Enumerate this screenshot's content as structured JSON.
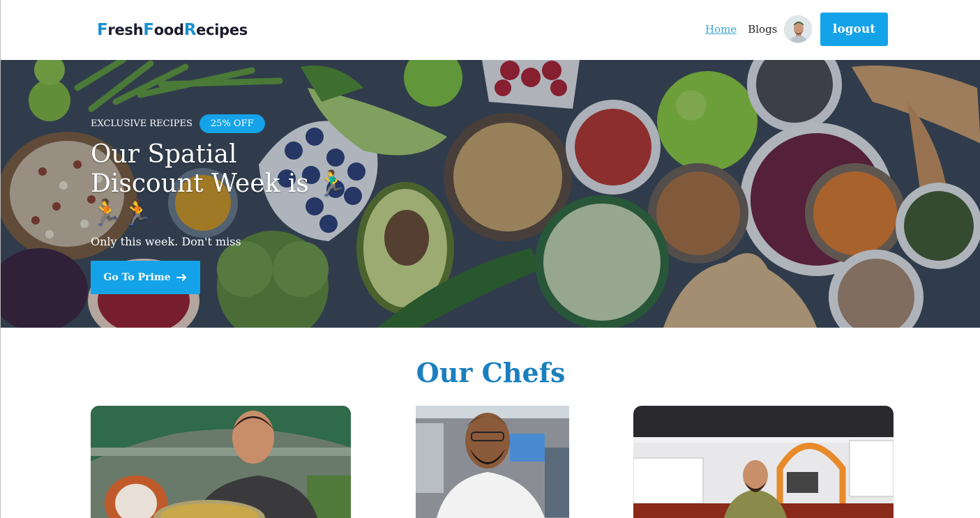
{
  "header": {
    "brand": [
      {
        "cap": "F",
        "rest": "resh"
      },
      {
        "cap": "F",
        "rest": "ood"
      },
      {
        "cap": "R",
        "rest": "ecipes"
      }
    ],
    "nav": {
      "home": "Home",
      "blogs": "Blogs"
    },
    "logout_label": "logout"
  },
  "hero": {
    "tag_text": "EXCLUSIVE RECIPES",
    "badge": "25% OFF",
    "title": "Our Spatial Discount Week is 🏃‍♂️🏃🏃",
    "subtitle": "Only this week. Don't miss",
    "cta_label": "Go To Prime",
    "cta_icon": "arrow-right-icon"
  },
  "chefs": {
    "title": "Our Chefs"
  },
  "colors": {
    "accent": "#14a3e8",
    "brand_cap": "#1a8fd0",
    "heading": "#1b7fbd"
  }
}
